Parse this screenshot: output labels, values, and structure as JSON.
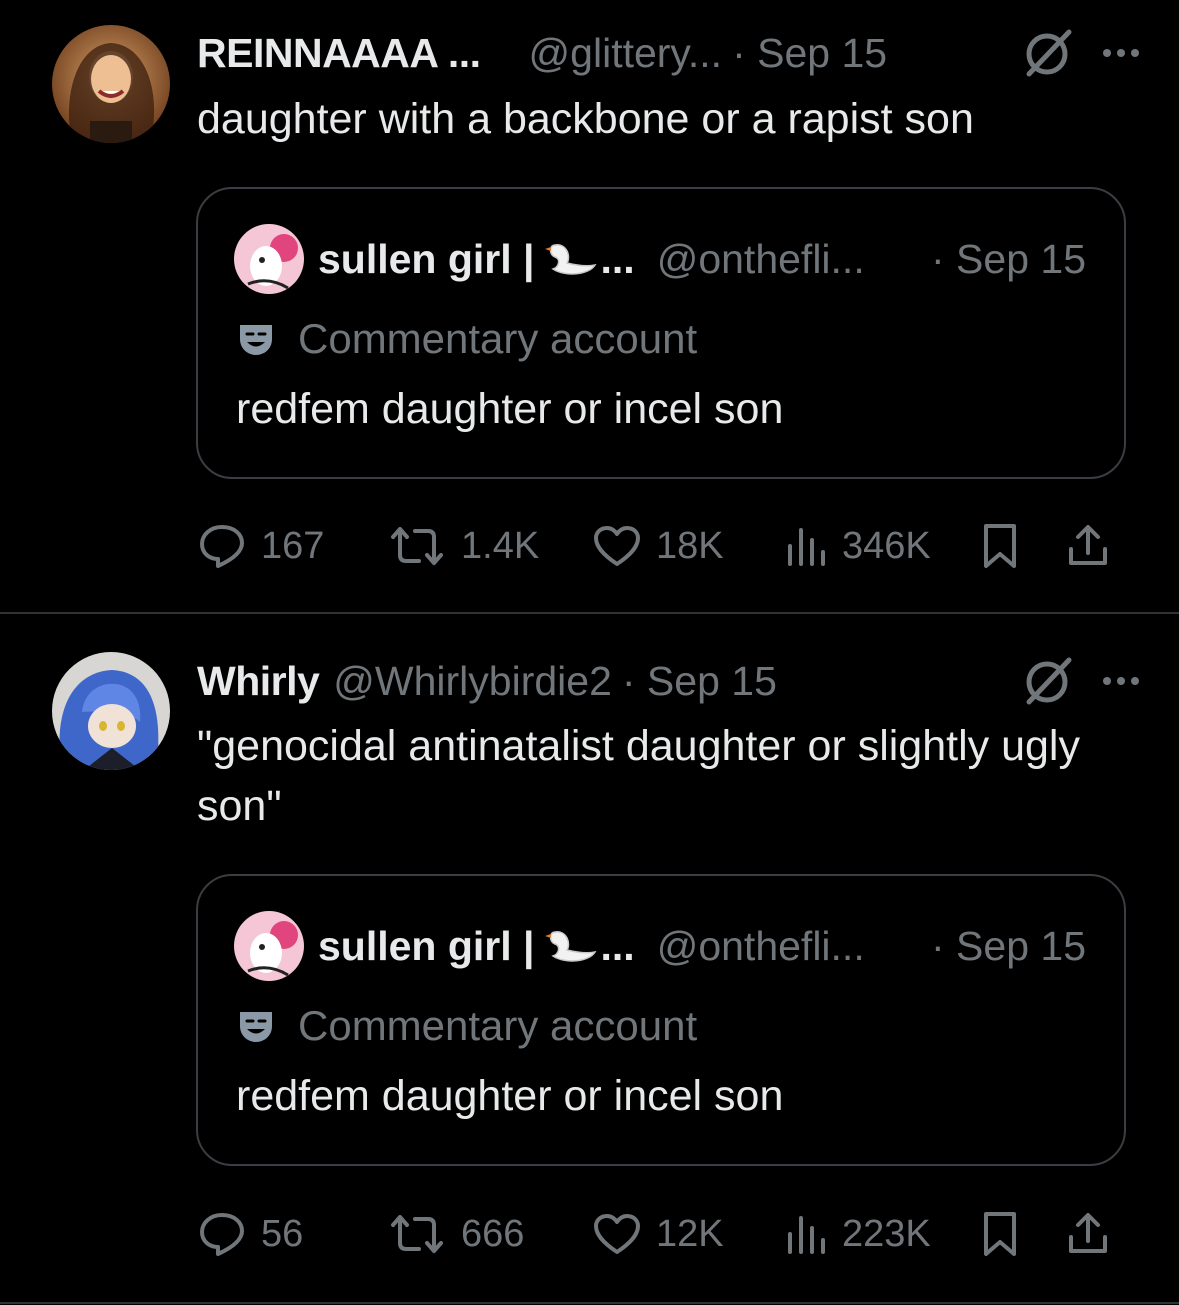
{
  "tweets": [
    {
      "author_name": "REINNAAAA ...",
      "handle": "@glittery...",
      "date": "· Sep 15",
      "text": "daughter with a backbone or a rapist son",
      "quote": {
        "author_name": "sullen girl |",
        "name_suffix": "...",
        "handle": "@onthefli...",
        "date": "· Sep 15",
        "label": "Commentary account",
        "text": "redfem daughter or incel son"
      },
      "stats": {
        "replies": "167",
        "reposts": "1.4K",
        "likes": "18K",
        "views": "346K"
      }
    },
    {
      "author_name": "Whirly",
      "handle": "@Whirlybirdie2",
      "date": "· Sep 15",
      "text": "\"genocidal antinatalist daughter or slightly ugly son\"",
      "quote": {
        "author_name": "sullen girl |",
        "name_suffix": "...",
        "handle": "@onthefli...",
        "date": "· Sep 15",
        "label": "Commentary account",
        "text": "redfem daughter or incel son"
      },
      "stats": {
        "replies": "56",
        "reposts": "666",
        "likes": "12K",
        "views": "223K"
      }
    }
  ],
  "icons": {
    "reply": "reply-icon",
    "repost": "repost-icon",
    "like": "heart-icon",
    "views": "views-icon",
    "bookmark": "bookmark-icon",
    "share": "share-icon",
    "grok": "grok-icon",
    "more": "more-icon",
    "label": "theater-mask-icon",
    "swan": "swan-emoji-icon"
  },
  "colors": {
    "background": "#000000",
    "text": "#e7e9ea",
    "muted": "#71767b",
    "border": "#3a3d41"
  }
}
